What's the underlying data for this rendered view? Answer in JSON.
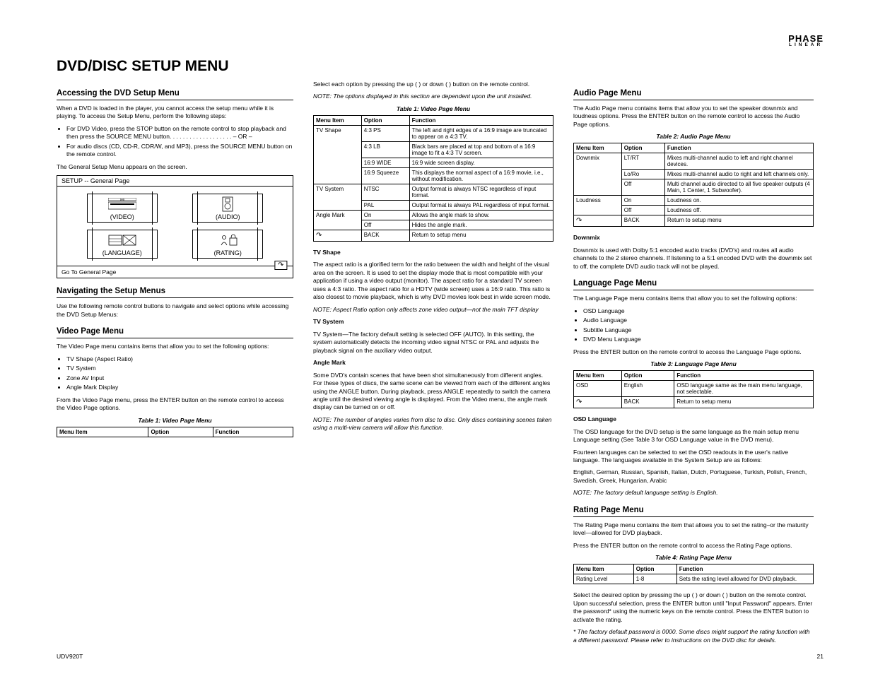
{
  "logo": {
    "brand": "PHASE",
    "sub": "LINEAR"
  },
  "title": "DVD/DISC SETUP MENU",
  "col1": {
    "sec1": {
      "heading": "Accessing the DVD Setup Menu",
      "p1": "When a DVD is loaded in the player, you cannot access the setup menu while it is playing. To access the Setup Menu, perform the following steps:",
      "li1": "For DVD Video, press the STOP button on the remote control to stop playback and then press the SOURCE MENU button. . . . . . . . . . . . . . . . . . . – OR –",
      "li2": "For audio discs (CD, CD-R, CDR/W, and MP3), press the SOURCE MENU button on the remote control.",
      "p2": "The General Setup Menu appears on the screen.",
      "screen_title": "SETUP -- General Page",
      "screen_hint": "Go To General Page",
      "items": {
        "video": "(VIDEO)",
        "audio": "(AUDIO)",
        "language": "(LANGUAGE)",
        "rating": "(RATING)"
      }
    },
    "sec2": {
      "heading": "Navigating the Setup Menus",
      "p": "Use the following remote control buttons to navigate and select options while accessing the DVD Setup Menus:"
    },
    "sec3": {
      "heading": "Video Page Menu",
      "p1": "The Video Page menu contains items that allow you to set the following options:",
      "li1": "TV Shape (Aspect Ratio)",
      "li2": "TV System",
      "li3": "Zone AV Input",
      "li4": "Angle Mark Display",
      "p2": "From the Video Page menu, press the ENTER button on the remote control to access the Video Page options.",
      "cap": "Table 1: Video Page Menu",
      "headers": [
        "Menu Item",
        "Option",
        "Function"
      ]
    }
  },
  "col2": {
    "p_nav": "Select each option by pressing the up (  ) or down (  ) button on the remote control.",
    "note1": "NOTE: The options displayed in this section are dependent upon the unit installed.",
    "cap1": "Table 1: Video Page Menu",
    "headers": [
      "Menu Item",
      "Option",
      "Function"
    ],
    "tv_shape_label": "TV Shape",
    "tv_shape": [
      [
        "4:3 PS",
        "The left and right edges of a 16:9 image are truncated to appear on a 4:3 TV."
      ],
      [
        "4:3 LB",
        "Black bars are placed at top and bottom of a 16:9 image to fit a 4:3 TV screen."
      ],
      [
        "16:9 WIDE",
        "16:9 wide screen display."
      ],
      [
        "16:9 Squeeze",
        "This displays the normal aspect of a 16:9 movie, i.e., without modification."
      ]
    ],
    "tv_system_label": "TV System",
    "tv_system": [
      [
        "NTSC",
        "Output format is always NTSC regardless of input format."
      ],
      [
        "PAL",
        "Output format is always PAL regardless of input format."
      ]
    ],
    "angle_label": "Angle Mark",
    "angle": [
      [
        "On",
        "Allows the angle mark to show."
      ],
      [
        "Off",
        "Hides the angle mark."
      ]
    ],
    "back": [
      "BACK",
      "Return to setup menu"
    ],
    "sec_tv_shape": {
      "h": "TV Shape",
      "p": "The aspect ratio is a glorified term for the ratio between the width and height of the visual area on the screen. It is used to set the display mode that is most compatible with your application if using a video output (monitor). The aspect ratio for a standard TV screen uses a 4:3 ratio. The aspect ratio for a HDTV (wide screen) uses a 16:9 ratio. This ratio is also closest to movie playback, which is why DVD movies look best in wide screen mode.",
      "note": "NOTE: Aspect Ratio option only affects zone video output—not the main TFT display"
    },
    "sec_tv_system": {
      "h": "TV System",
      "p": "TV System—The factory default setting is selected OFF (AUTO). In this setting, the system automatically detects the incoming video signal NTSC or PAL and adjusts the playback signal on the auxiliary video output."
    },
    "sec_angle": {
      "h": "Angle Mark",
      "p": "Some DVD's contain scenes that have been shot simultaneously from different angles. For these types of discs, the same scene can be viewed from each of the different angles using the ANGLE button. During playback, press ANGLE repeatedly to switch the camera angle until the desired viewing angle is displayed. From the Video menu, the angle mark display can be turned on or off.",
      "note": "NOTE: The number of angles varies from disc to disc. Only discs containing scenes taken using a multi-view camera will allow this function."
    }
  },
  "col3": {
    "sec_audio": {
      "h": "Audio Page Menu",
      "p": "The Audio Page menu contains items that allow you to set the speaker downmix and loudness options. Press the ENTER button on the remote control to access the Audio Page options.",
      "cap": "Table 2: Audio Page Menu",
      "headers": [
        "Menu Item",
        "Option",
        "Function"
      ],
      "downmix_label": "Downmix",
      "downmix": [
        [
          "LT/RT",
          "Mixes multi-channel audio to left and right channel devices."
        ],
        [
          "Lo/Ro",
          "Mixes multi-channel audio to right and left channels only."
        ],
        [
          "Off",
          "Multi channel audio directed to all five speaker outputs (4 Main, 1 Center, 1 Subwoofer)."
        ]
      ],
      "loudness_label": "Loudness",
      "loudness": [
        [
          "On",
          "Loudness on."
        ],
        [
          "Off",
          "Loudness off."
        ]
      ],
      "back": [
        "BACK",
        "Return to setup menu"
      ]
    },
    "sec_downmix": {
      "h": "Downmix",
      "p": "Downmix is used with Dolby 5:1 encoded audio tracks (DVD's) and routes all audio channels to the 2 stereo channels. If listening to a 5:1 encoded DVD with the downmix set to off, the complete DVD audio track will not be played."
    },
    "sec_lang": {
      "h": "Language Page Menu",
      "p": "The Language Page menu contains items that allow you to set the following options:",
      "li": [
        "OSD Language",
        "Audio Language",
        "Subtitle Language",
        "DVD Menu Language"
      ],
      "p2": "Press the ENTER button on the remote control to access the Language Page options.",
      "cap": "Table 3: Language Page Menu",
      "headers": [
        "Menu Item",
        "Option",
        "Function"
      ],
      "osd_label": "OSD",
      "osd": [
        [
          "English",
          "OSD language same as the main menu language, not selectable."
        ]
      ],
      "back": [
        "BACK",
        "Return to setup menu"
      ]
    },
    "sec_osd": {
      "h": "OSD Language",
      "p1": "The OSD language for the DVD setup is the same language as the main setup menu Language setting (See Table 3 for OSD Language value in the DVD menu).",
      "p2": "Fourteen languages can be selected to set the OSD readouts in the user's native language. The languages available in the System Setup are as follows:",
      "langs": "English, German, Russian, Spanish, Italian, Dutch, Portuguese, Turkish, Polish, French, Swedish, Greek, Hungarian, Arabic",
      "note": "NOTE: The factory default language setting is English."
    },
    "sec_rating": {
      "h": "Rating Page Menu",
      "p1": "The Rating Page menu contains the item that allows you to set the rating–or the maturity level—allowed for DVD playback.",
      "p2": "Press the ENTER button on the remote control to access the Rating Page options.",
      "cap": "Table 4: Rating Page Menu",
      "headers": [
        "Menu Item",
        "Option",
        "Function"
      ],
      "rating_label": "Rating Level",
      "rating": [
        [
          "1-8",
          "Sets the rating level allowed for DVD playback."
        ]
      ],
      "p3": "Select the desired option by pressing the up (  ) or down (  ) button on the remote control. Upon successful selection, press the ENTER button until \"Input Password\" appears. Enter the password* using the numeric keys on the remote control. Press the ENTER button to activate the rating.",
      "note": "* The factory default password is 0000. Some discs might support the rating function with a different password. Please refer to instructions on the DVD disc for details."
    }
  },
  "footer": {
    "left": "UDV920T",
    "right": "21"
  }
}
